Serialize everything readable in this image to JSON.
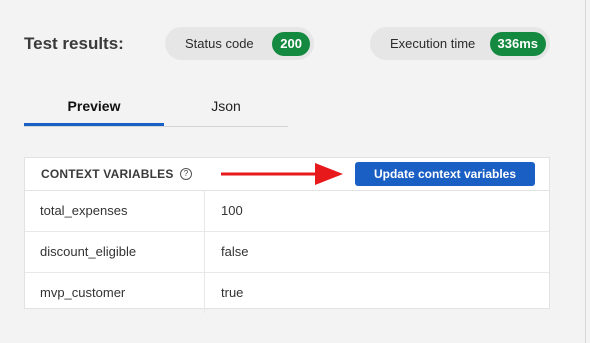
{
  "header": {
    "title": "Test results:",
    "status": {
      "label": "Status code",
      "value": "200"
    },
    "execution": {
      "label": "Execution time",
      "value": "336ms"
    }
  },
  "tabs": [
    {
      "label": "Preview",
      "active": true
    },
    {
      "label": "Json",
      "active": false
    }
  ],
  "context": {
    "heading": "CONTEXT VARIABLES",
    "help_icon": "question-circle-icon",
    "update_button": "Update context variables",
    "annotation_color": "#e8191b",
    "rows": [
      {
        "key": "total_expenses",
        "value": "100"
      },
      {
        "key": "discount_eligible",
        "value": "false"
      },
      {
        "key": "mvp_customer",
        "value": "true"
      }
    ]
  },
  "colors": {
    "accent": "#1a5fc4",
    "badge": "#138a3f"
  }
}
